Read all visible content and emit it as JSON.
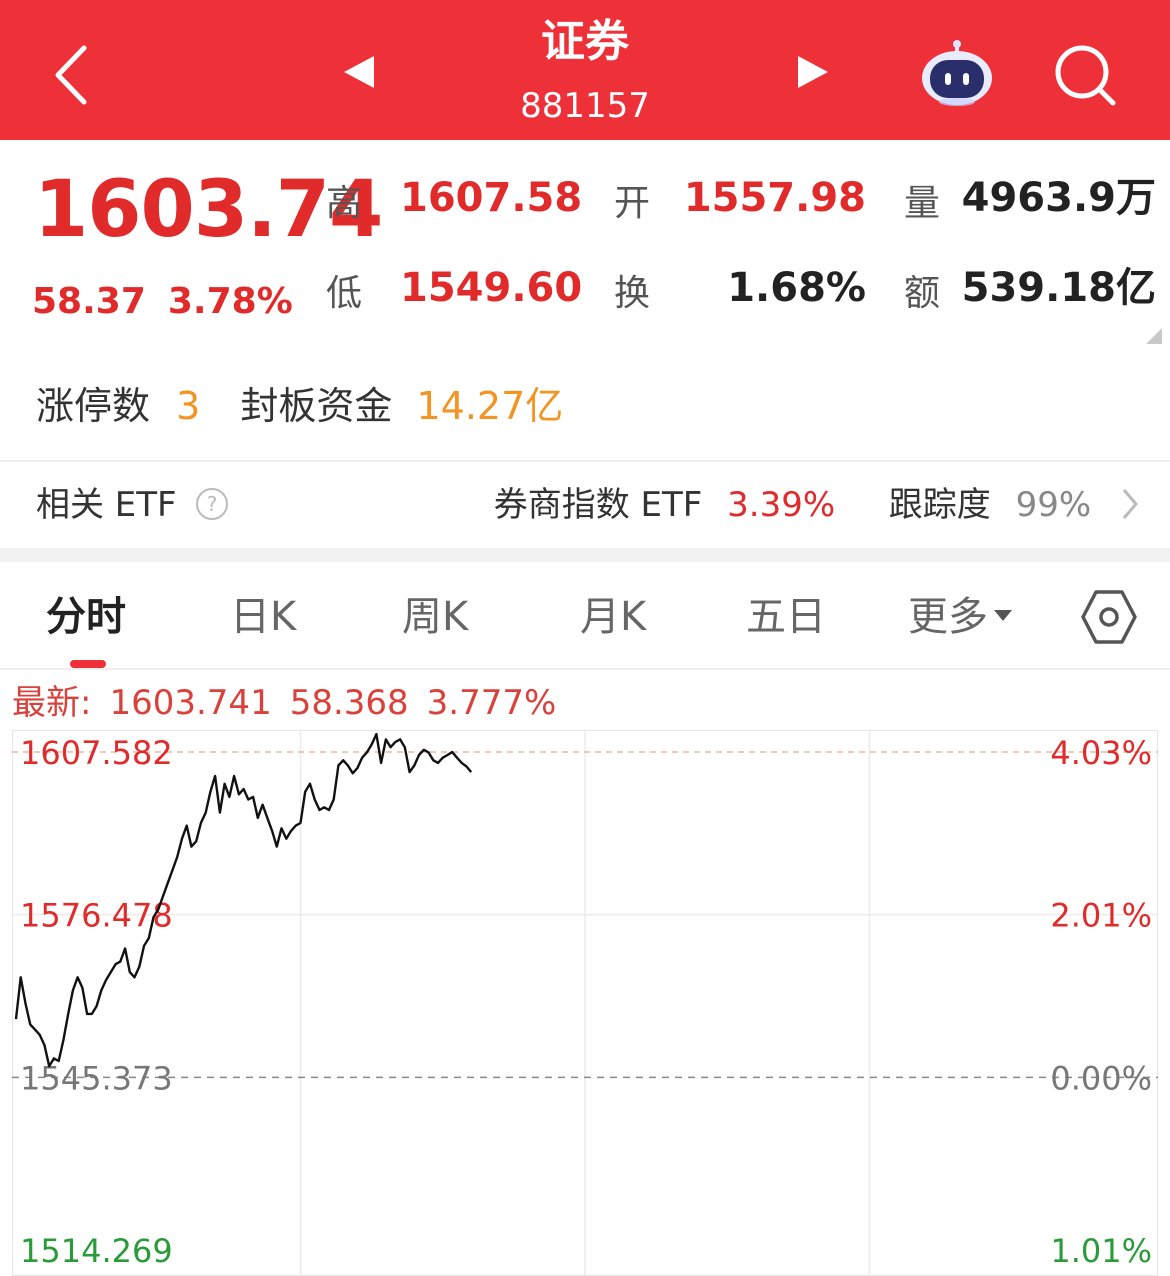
{
  "header": {
    "title": "证券",
    "code": "881157",
    "bg_color": "#ee3039",
    "back_icon": "chevron-left-icon",
    "prev_icon": "triangle-left-icon",
    "next_icon": "triangle-right-icon",
    "assistant_icon": "robot-icon",
    "search_icon": "search-icon"
  },
  "quote": {
    "price": "1603.74",
    "change": "58.37",
    "change_pct": "3.78%",
    "high_label": "高",
    "high": "1607.58",
    "open_label": "开",
    "open": "1557.98",
    "volume_label": "量",
    "volume": "4963.9万",
    "low_label": "低",
    "low": "1549.60",
    "turnover_label": "换",
    "turnover": "1.68%",
    "amount_label": "额",
    "amount": "539.18亿"
  },
  "limit_up": {
    "count_label": "涨停数",
    "count": "3",
    "fund_label": "封板资金",
    "fund": "14.27亿"
  },
  "etf": {
    "label": "相关 ETF",
    "name": "券商指数 ETF",
    "pct": "3.39%",
    "track_label": "跟踪度",
    "track": "99%"
  },
  "tabs": {
    "items": [
      "分时",
      "日K",
      "周K",
      "月K",
      "五日",
      "更多"
    ],
    "active": "分时"
  },
  "latest": {
    "label": "最新:",
    "price": "1603.741",
    "change": "58.368",
    "pct": "3.777%"
  },
  "chart_data": {
    "type": "line",
    "y_ticks_left": [
      "1607.582",
      "1576.478",
      "1545.373",
      "1514.269"
    ],
    "y_ticks_right": [
      "4.03%",
      "2.01%",
      "0.00%",
      "1.01%"
    ],
    "ylim": [
      1514.269,
      1607.582
    ],
    "reference": 1545.373,
    "x_total_minutes": 240,
    "series": [
      {
        "x": [
          0,
          1,
          2,
          3,
          4,
          5,
          6,
          7,
          8,
          9,
          10,
          11,
          12,
          13,
          14,
          15,
          16,
          17,
          18,
          19,
          20,
          21,
          22,
          23,
          24,
          25,
          26,
          27,
          28,
          29,
          30,
          31,
          32,
          33,
          34,
          35,
          36,
          37,
          38,
          39,
          40,
          41,
          42,
          43,
          44,
          45,
          46,
          47,
          48,
          49,
          50,
          51,
          52,
          53,
          54,
          55,
          56,
          57,
          58,
          59,
          60,
          61,
          62,
          63,
          64,
          65,
          66,
          67,
          68,
          69,
          70,
          71,
          72,
          73,
          74,
          75,
          76,
          77,
          78,
          79,
          80,
          81,
          82,
          83,
          84,
          85,
          86,
          87,
          88,
          89,
          90,
          91,
          92,
          93,
          94,
          95,
          96
        ],
        "y": [
          1556.5,
          1564.5,
          1559.5,
          1555.5,
          1554.5,
          1553.5,
          1551.5,
          1547.5,
          1549.0,
          1548.5,
          1552.5,
          1557.5,
          1562.0,
          1564.5,
          1562.5,
          1557.5,
          1557.5,
          1559.0,
          1562.0,
          1564.0,
          1565.5,
          1567.0,
          1567.5,
          1570.0,
          1565.5,
          1564.5,
          1566.5,
          1570.5,
          1572.0,
          1576.0,
          1577.5,
          1580.0,
          1582.5,
          1585.0,
          1587.5,
          1591.0,
          1593.5,
          1589.5,
          1590.5,
          1594.0,
          1596.0,
          1600.0,
          1603.0,
          1596.0,
          1601.5,
          1599.0,
          1603.0,
          1599.5,
          1600.5,
          1598.5,
          1599.0,
          1595.0,
          1597.5,
          1595.0,
          1592.5,
          1589.5,
          1593.0,
          1591.0,
          1592.5,
          1593.5,
          1594.0,
          1600.0,
          1601.5,
          1598.5,
          1596.5,
          1597.0,
          1596.5,
          1598.5,
          1605.0,
          1606.0,
          1605.0,
          1603.5,
          1604.5,
          1606.5,
          1607.5,
          1609.0,
          1611.0,
          1605.5,
          1610.0,
          1608.5,
          1609.5,
          1610.0,
          1608.5,
          1603.74,
          1605.0,
          1607.0,
          1608.0,
          1607.5,
          1606.0,
          1605.5,
          1606.5,
          1607.0,
          1607.58,
          1606.5,
          1605.5,
          1604.8,
          1603.74
        ]
      }
    ],
    "up_color": "#e12a2a",
    "down_color": "#2a9a3a",
    "grid": true
  }
}
